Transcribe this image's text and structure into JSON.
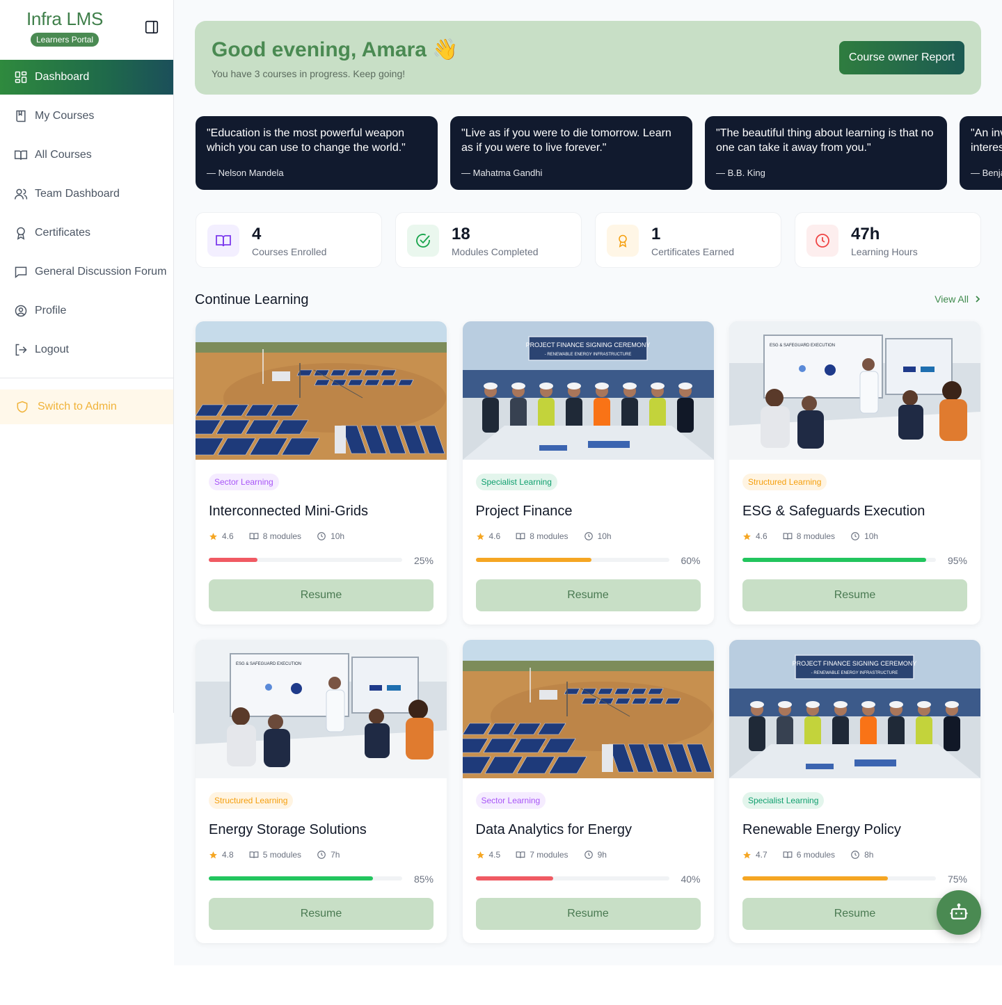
{
  "brand": {
    "name": "Infra LMS",
    "badge": "Learners Portal"
  },
  "sidebar": {
    "items": [
      {
        "label": "Dashboard",
        "icon": "dashboard-icon",
        "active": true
      },
      {
        "label": "My Courses",
        "icon": "bookmark-book-icon"
      },
      {
        "label": "All Courses",
        "icon": "open-book-icon"
      },
      {
        "label": "Team Dashboard",
        "icon": "users-icon"
      },
      {
        "label": "Certificates",
        "icon": "award-icon"
      },
      {
        "label": "General Discussion Forum",
        "icon": "chat-icon"
      },
      {
        "label": "Profile",
        "icon": "user-circle-icon"
      },
      {
        "label": "Logout",
        "icon": "logout-icon"
      }
    ],
    "switch_admin": "Switch to Admin"
  },
  "greeting": {
    "title": "Good evening, Amara 👋",
    "subtitle": "You have 3 courses in progress. Keep going!",
    "report_button": "Course owner Report"
  },
  "quotes": [
    {
      "text": "\"Education is the most powerful weapon which you can use to change the world.\"",
      "author": "— Nelson Mandela"
    },
    {
      "text": "\"Live as if you were to die tomorrow. Learn as if you were to live forever.\"",
      "author": "— Mahatma Gandhi"
    },
    {
      "text": "\"The beautiful thing about learning is that no one can take it away from you.\"",
      "author": "— B.B. King"
    },
    {
      "text": "\"An investment in knowledge pays the best interest.\"",
      "author": "— Benjamin Franklin"
    }
  ],
  "stats": [
    {
      "value": "4",
      "label": "Courses Enrolled",
      "icon": "book-icon",
      "color": "#7c3aed",
      "bg": "#f3efff"
    },
    {
      "value": "18",
      "label": "Modules Completed",
      "icon": "check-circle-icon",
      "color": "#16a34a",
      "bg": "#eaf7ee"
    },
    {
      "value": "1",
      "label": "Certificates Earned",
      "icon": "award-icon",
      "color": "#f59e0b",
      "bg": "#fff6e6"
    },
    {
      "value": "47h",
      "label": "Learning Hours",
      "icon": "clock-icon",
      "color": "#ef4444",
      "bg": "#fdeeee"
    }
  ],
  "continue_learning": {
    "title": "Continue Learning",
    "view_all": "View All"
  },
  "colors": {
    "accent": "#4a8a52",
    "sector": "#a855f7",
    "specialist": "#0f9f6e",
    "structured": "#f59e0b",
    "progress_red": "#f05a63",
    "progress_orange": "#f5a623",
    "progress_green": "#22c55e"
  },
  "courses": [
    {
      "tag": "Sector Learning",
      "tag_type": "sector",
      "title": "Interconnected Mini-Grids",
      "rating": "4.6",
      "modules": "8 modules",
      "hours": "10h",
      "progress": 25,
      "progress_label": "25%",
      "image": "solar-field",
      "button": "Resume"
    },
    {
      "tag": "Specialist Learning",
      "tag_type": "specialist",
      "title": "Project Finance",
      "rating": "4.6",
      "modules": "8 modules",
      "hours": "10h",
      "progress": 60,
      "progress_label": "60%",
      "image": "ceremony",
      "button": "Resume"
    },
    {
      "tag": "Structured Learning",
      "tag_type": "structured",
      "title": "ESG & Safeguards Execution",
      "rating": "4.6",
      "modules": "8 modules",
      "hours": "10h",
      "progress": 95,
      "progress_label": "95%",
      "image": "meeting",
      "button": "Resume"
    },
    {
      "tag": "Structured Learning",
      "tag_type": "structured",
      "title": "Energy Storage Solutions",
      "rating": "4.8",
      "modules": "5 modules",
      "hours": "7h",
      "progress": 85,
      "progress_label": "85%",
      "image": "meeting",
      "button": "Resume"
    },
    {
      "tag": "Sector Learning",
      "tag_type": "sector",
      "title": "Data Analytics for Energy",
      "rating": "4.5",
      "modules": "7 modules",
      "hours": "9h",
      "progress": 40,
      "progress_label": "40%",
      "image": "solar-field",
      "button": "Resume"
    },
    {
      "tag": "Specialist Learning",
      "tag_type": "specialist",
      "title": "Renewable Energy Policy",
      "rating": "4.7",
      "modules": "6 modules",
      "hours": "8h",
      "progress": 75,
      "progress_label": "75%",
      "image": "ceremony",
      "button": "Resume"
    }
  ],
  "images": {
    "ceremony_banner_1": "PROJECT FINANCE SIGNING CEREMONY",
    "ceremony_banner_2": "- RENEWABLE ENERGY INFRASTRUCTURE",
    "meeting_screen": "ESG & SAFEGUARD EXECUTION"
  }
}
